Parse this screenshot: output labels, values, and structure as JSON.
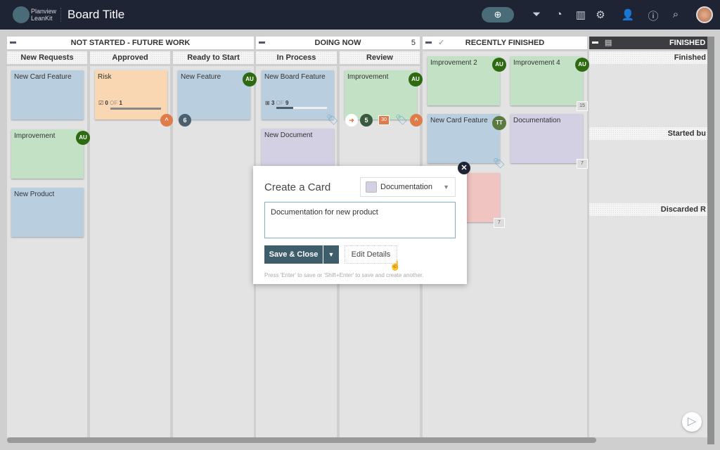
{
  "header": {
    "brand_line1": "Planview",
    "brand_line2": "LeanKit",
    "title": "Board Title",
    "icons": [
      "add-card-icon",
      "filter-icon",
      "timeline-icon",
      "analytics-icon",
      "settings-icon",
      "invite-user-icon",
      "info-icon",
      "search-icon",
      "user-avatar"
    ]
  },
  "lanes": {
    "not_started": {
      "title": "NOT STARTED - FUTURE WORK",
      "columns": [
        "New Requests",
        "Approved",
        "Ready to Start"
      ]
    },
    "doing_now": {
      "title": "DOING NOW",
      "wip": "5",
      "columns": [
        "In Process",
        "Review"
      ]
    },
    "recently_finished": {
      "title": "RECENTLY FINISHED"
    },
    "finished": {
      "title": "FINISHED -",
      "sublanes": [
        "Finished",
        "Started bu",
        "Discarded R"
      ]
    }
  },
  "cards": {
    "new_card_feature": "New Card Feature",
    "improvement": "Improvement",
    "new_product": "New Product",
    "risk": "Risk",
    "risk_progress": {
      "done": "0",
      "of": "OF",
      "total": "1"
    },
    "new_feature": "New Feature",
    "new_feature_badge": "6",
    "new_board_feature": "New Board Feature",
    "nbf_progress": {
      "done": "3",
      "of": "OF",
      "total": "9"
    },
    "new_document": "New Document",
    "review_improvement": "Improvement",
    "review_badge": "5",
    "review_date": "30",
    "improvement2": "Improvement 2",
    "improvement4": "Improvement 4",
    "imp4_date": "15",
    "rf_new_card_feature": "New Card Feature",
    "documentation": "Documentation",
    "doc_date": "7",
    "pink_date": "7",
    "assignee_au": "AU",
    "assignee_tt": "TT"
  },
  "modal": {
    "title": "Create a Card",
    "type": "Documentation",
    "type_color": "#d3d0e3",
    "text": "Documentation for new product",
    "save": "Save & Close",
    "edit": "Edit Details",
    "hint": "Press 'Enter' to save or 'Shift+Enter' to save and create another."
  }
}
